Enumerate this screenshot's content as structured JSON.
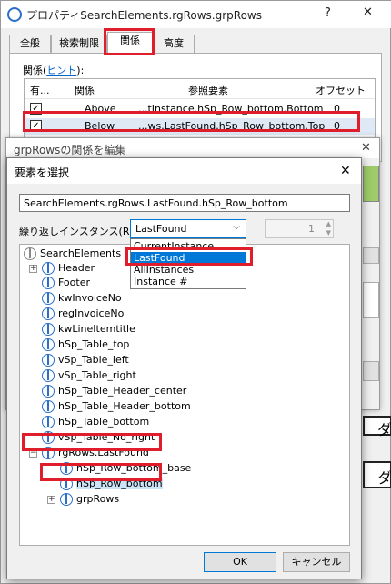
{
  "prop_window": {
    "title": "プロパティSearchElements.rgRows.grpRows",
    "help_label": "?",
    "close_label": "✕",
    "tabs": [
      "全般",
      "検索制限",
      "関係",
      "高度"
    ],
    "relation_label_prefix": "関係(",
    "relation_link": "ヒント",
    "relation_label_suffix": "):",
    "columns": [
      "有...",
      "関係",
      "参照要素",
      "オフセット"
    ],
    "rows": [
      {
        "enabled": true,
        "relation": "Above",
        "ref": "...tInstance.hSp_Row_bottom.Bottom",
        "offset": "0"
      },
      {
        "enabled": true,
        "relation": "Below",
        "ref": "...ws.LastFound.hSp_Row_bottom.Top",
        "offset": "0"
      }
    ]
  },
  "mid_window": {
    "title": "grpRowsの関係を編集",
    "close_label": "✕"
  },
  "bg_fragments": [
    "ダ",
    "ダ"
  ],
  "dialog": {
    "title": "要素を選択",
    "close_label": "✕",
    "path_value": "SearchElements.rgRows.LastFound.hSp_Row_bottom",
    "repeat_label": "繰り返しインスタンス(R):",
    "repeat_selected": "LastFound",
    "repeat_options": [
      "CurrentInstance",
      "LastFound",
      "AllInstances",
      "Instance #"
    ],
    "spinner_value": "1",
    "tree": [
      {
        "label": "SearchElements",
        "level": 0,
        "icon": "search-elements-icon"
      },
      {
        "label": "Header",
        "level": 1,
        "icon": "header-icon",
        "expandable": true
      },
      {
        "label": "Footer",
        "level": 1,
        "icon": "footer-icon"
      },
      {
        "label": "kwInvoiceNo",
        "level": 1,
        "icon": "keyword-icon"
      },
      {
        "label": "regInvoiceNo",
        "level": 1,
        "icon": "regex-icon"
      },
      {
        "label": "kwLineItemtitle",
        "level": 1,
        "icon": "keyword-icon"
      },
      {
        "label": "hSp_Table_top",
        "level": 1,
        "icon": "hspace-icon"
      },
      {
        "label": "vSp_Table_left",
        "level": 1,
        "icon": "vspace-icon"
      },
      {
        "label": "vSp_Table_right",
        "level": 1,
        "icon": "vspace-icon"
      },
      {
        "label": "hSp_Table_Header_center",
        "level": 1,
        "icon": "hspace-icon"
      },
      {
        "label": "hSp_Table_Header_bottom",
        "level": 1,
        "icon": "hspace-icon"
      },
      {
        "label": "hSp_Table_bottom",
        "level": 1,
        "icon": "hspace-icon"
      },
      {
        "label": "vSp_Table_No_right",
        "level": 1,
        "icon": "vspace-icon"
      },
      {
        "label": "rgRows.LastFound",
        "level": 1,
        "icon": "repeating-group-icon",
        "expandable": true,
        "expanded": true
      },
      {
        "label": "hSp_Row_bottom_base",
        "level": 2,
        "icon": "hspace-icon"
      },
      {
        "label": "hSp_Row_bottom",
        "level": 2,
        "icon": "hspace-icon",
        "selected": true
      },
      {
        "label": "grpRows",
        "level": 2,
        "icon": "group-icon",
        "expandable": true
      }
    ],
    "ok_label": "OK",
    "cancel_label": "キャンセル"
  },
  "colors": {
    "highlight_red": "#e01e2b",
    "selection_blue": "#0078d7"
  }
}
